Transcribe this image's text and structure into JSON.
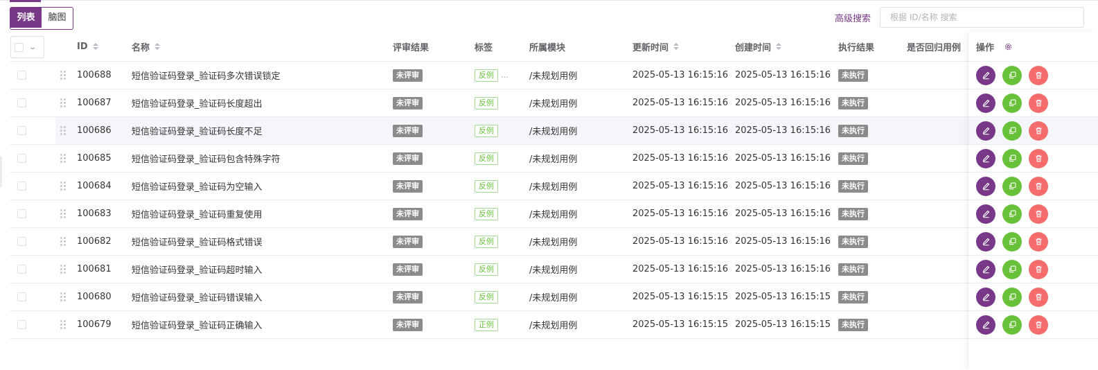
{
  "view_toggle": {
    "list_label": "列表",
    "mind_label": "脑图"
  },
  "search": {
    "advanced_label": "高级搜索",
    "placeholder": "根据 ID/名称 搜索",
    "value": ""
  },
  "columns": {
    "id": "ID",
    "name": "名称",
    "review": "评审结果",
    "tags": "标签",
    "module": "所属模块",
    "updated": "更新时间",
    "created": "创建时间",
    "exec": "执行结果",
    "regression": "是否回归用例",
    "ops": "操作"
  },
  "rows": [
    {
      "id": "100688",
      "name": "短信验证码登录_验证码多次错误锁定",
      "review": "未评审",
      "tag": "反例",
      "more": "…",
      "module": "/未规划用例",
      "updated": "2025-05-13 16:15:16",
      "created": "2025-05-13 16:15:16",
      "exec": "未执行"
    },
    {
      "id": "100687",
      "name": "短信验证码登录_验证码长度超出",
      "review": "未评审",
      "tag": "反例",
      "more": "",
      "module": "/未规划用例",
      "updated": "2025-05-13 16:15:16",
      "created": "2025-05-13 16:15:16",
      "exec": "未执行"
    },
    {
      "id": "100686",
      "name": "短信验证码登录_验证码长度不足",
      "review": "未评审",
      "tag": "反例",
      "more": "",
      "module": "/未规划用例",
      "updated": "2025-05-13 16:15:16",
      "created": "2025-05-13 16:15:16",
      "exec": "未执行"
    },
    {
      "id": "100685",
      "name": "短信验证码登录_验证码包含特殊字符",
      "review": "未评审",
      "tag": "反例",
      "more": "",
      "module": "/未规划用例",
      "updated": "2025-05-13 16:15:16",
      "created": "2025-05-13 16:15:16",
      "exec": "未执行"
    },
    {
      "id": "100684",
      "name": "短信验证码登录_验证码为空输入",
      "review": "未评审",
      "tag": "反例",
      "more": "",
      "module": "/未规划用例",
      "updated": "2025-05-13 16:15:16",
      "created": "2025-05-13 16:15:16",
      "exec": "未执行"
    },
    {
      "id": "100683",
      "name": "短信验证码登录_验证码重复使用",
      "review": "未评审",
      "tag": "反例",
      "more": "",
      "module": "/未规划用例",
      "updated": "2025-05-13 16:15:16",
      "created": "2025-05-13 16:15:16",
      "exec": "未执行"
    },
    {
      "id": "100682",
      "name": "短信验证码登录_验证码格式错误",
      "review": "未评审",
      "tag": "反例",
      "more": "",
      "module": "/未规划用例",
      "updated": "2025-05-13 16:15:16",
      "created": "2025-05-13 16:15:16",
      "exec": "未执行"
    },
    {
      "id": "100681",
      "name": "短信验证码登录_验证码超时输入",
      "review": "未评审",
      "tag": "反例",
      "more": "",
      "module": "/未规划用例",
      "updated": "2025-05-13 16:15:16",
      "created": "2025-05-13 16:15:16",
      "exec": "未执行"
    },
    {
      "id": "100680",
      "name": "短信验证码登录_验证码错误输入",
      "review": "未评审",
      "tag": "反例",
      "more": "",
      "module": "/未规划用例",
      "updated": "2025-05-13 16:15:15",
      "created": "2025-05-13 16:15:15",
      "exec": "未执行"
    },
    {
      "id": "100679",
      "name": "短信验证码登录_验证码正确输入",
      "review": "未评审",
      "tag": "正例",
      "more": "",
      "module": "/未规划用例",
      "updated": "2025-05-13 16:15:15",
      "created": "2025-05-13 16:15:15",
      "exec": "未执行"
    }
  ],
  "icons": {
    "sort": "sort-caret-icon",
    "drag": "drag-handle-icon",
    "edit": "edit-pen-icon",
    "copy": "copy-icon",
    "delete": "trash-icon",
    "settings": "gear-icon",
    "dropdown": "chevron-down-icon"
  },
  "colors": {
    "brand": "#783887",
    "success": "#67c23a",
    "danger": "#f56c6c",
    "badge_gray": "#8b8b8b"
  },
  "highlighted_row": 2
}
